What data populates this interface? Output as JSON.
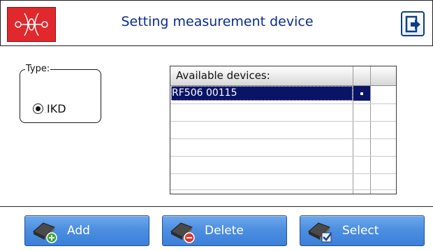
{
  "header": {
    "title": "Setting measurement device"
  },
  "type_group": {
    "legend": "Type:",
    "options": [
      {
        "label": "IKD",
        "selected": true
      }
    ]
  },
  "devices": {
    "columns": [
      "Available devices:",
      "",
      ""
    ],
    "rows": [
      {
        "name": "RF506 00115",
        "mark": "•",
        "selected": true
      }
    ],
    "empty_rows": 5
  },
  "footer": {
    "add_label": "Add",
    "delete_label": "Delete",
    "select_label": "Select"
  },
  "colors": {
    "title_text": "#0b2a8f",
    "logo_bg": "#e0282d",
    "button_blue": "#4d8fe0",
    "selection_bg": "#0a1466"
  },
  "icons": {
    "logo": "sensor-logo-icon",
    "exit": "exit-icon",
    "add": "device-add-icon",
    "delete": "device-delete-icon",
    "select": "device-select-icon"
  }
}
